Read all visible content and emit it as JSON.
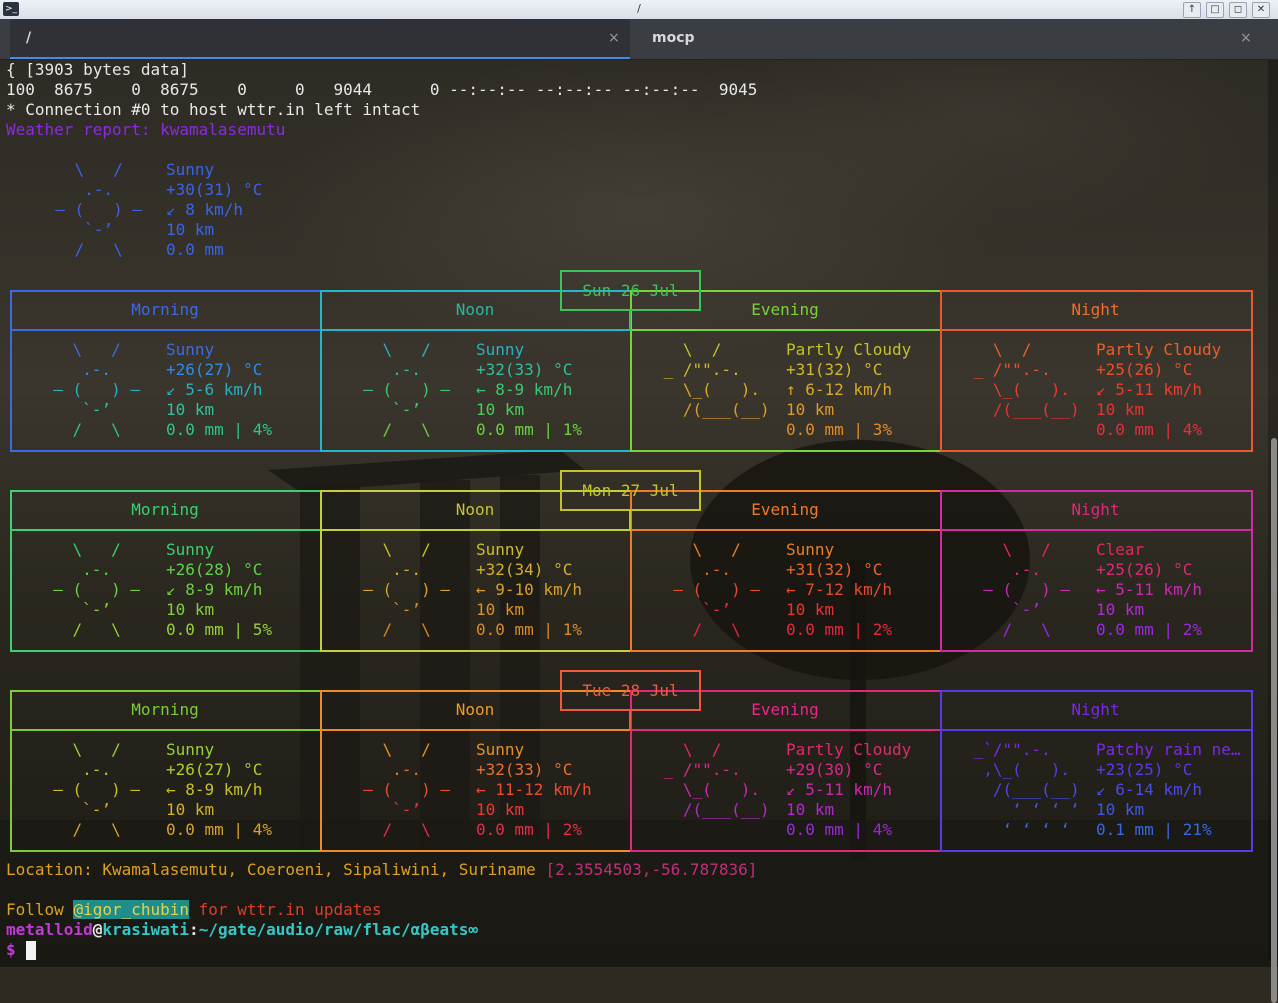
{
  "window": {
    "title": "/",
    "app_icon": ">_",
    "buttons": [
      "↑",
      "□",
      "◻",
      "✕"
    ]
  },
  "tabs": [
    {
      "label": "/",
      "active": true,
      "close": "×"
    },
    {
      "label": "mocp",
      "active": false,
      "close": "×"
    }
  ],
  "terminal": {
    "curl_lines": [
      "{ [3903 bytes data]",
      "100  8675    0  8675    0     0   9044      0 --:--:-- --:--:-- --:--:--  9045",
      "* Connection #0 to host wttr.in left intact"
    ],
    "report_title": "Weather report: kwamalasemutu",
    "current": {
      "art": [
        "    \\   /    ",
        "     .-.     ",
        "  ― (   ) ―  ",
        "     `-’     ",
        "    /   \\    "
      ],
      "info": [
        "Sunny",
        "+30(31) °C",
        "↙ 8 km/h",
        "10 km",
        "0.0 mm"
      ]
    },
    "days": [
      {
        "date": "Sun 26 Jul",
        "periods": [
          {
            "name": "Morning",
            "art": [
              "    \\   /    ",
              "     .-.     ",
              "  ― (   ) ―  ",
              "     `-’     ",
              "    /   \\    "
            ],
            "info": [
              "Sunny",
              "+26(27) °C",
              "↙ 5-6 km/h",
              "10 km",
              "0.0 mm | 4%"
            ]
          },
          {
            "name": "Noon",
            "art": [
              "    \\   /    ",
              "     .-.     ",
              "  ― (   ) ―  ",
              "     `-’     ",
              "    /   \\    "
            ],
            "info": [
              "Sunny",
              "+32(33) °C",
              "← 8-9 km/h",
              "10 km",
              "0.0 mm | 1%"
            ]
          },
          {
            "name": "Evening",
            "art": [
              "   \\  /      ",
              " _ /\"\".-.    ",
              "   \\_(   ).  ",
              "   /(___(__) ",
              "             "
            ],
            "info": [
              "Partly Cloudy",
              "+31(32) °C",
              "↑ 6-12 km/h",
              "10 km",
              "0.0 mm | 3%"
            ]
          },
          {
            "name": "Night",
            "art": [
              "   \\  /      ",
              " _ /\"\".-.    ",
              "   \\_(   ).  ",
              "   /(___(__) ",
              "             "
            ],
            "info": [
              "Partly Cloudy",
              "+25(26) °C",
              "↙ 5-11 km/h",
              "10 km",
              "0.0 mm | 4%"
            ]
          }
        ]
      },
      {
        "date": "Mon 27 Jul",
        "periods": [
          {
            "name": "Morning",
            "art": [
              "    \\   /    ",
              "     .-.     ",
              "  ― (   ) ―  ",
              "     `-’     ",
              "    /   \\    "
            ],
            "info": [
              "Sunny",
              "+26(28) °C",
              "↙ 8-9 km/h",
              "10 km",
              "0.0 mm | 5%"
            ]
          },
          {
            "name": "Noon",
            "art": [
              "    \\   /    ",
              "     .-.     ",
              "  ― (   ) ―  ",
              "     `-’     ",
              "    /   \\    "
            ],
            "info": [
              "Sunny",
              "+32(34) °C",
              "← 9-10 km/h",
              "10 km",
              "0.0 mm | 1%"
            ]
          },
          {
            "name": "Evening",
            "art": [
              "    \\   /    ",
              "     .-.     ",
              "  ― (   ) ―  ",
              "     `-’     ",
              "    /   \\    "
            ],
            "info": [
              "Sunny",
              "+31(32) °C",
              "← 7-12 km/h",
              "10 km",
              "0.0 mm | 2%"
            ]
          },
          {
            "name": "Night",
            "art": [
              "    \\   /    ",
              "     .-.     ",
              "  ― (   ) ―  ",
              "     `-’     ",
              "    /   \\    "
            ],
            "info": [
              "Clear",
              "+25(26) °C",
              "← 5-11 km/h",
              "10 km",
              "0.0 mm | 2%"
            ]
          }
        ]
      },
      {
        "date": "Tue 28 Jul",
        "periods": [
          {
            "name": "Morning",
            "art": [
              "    \\   /    ",
              "     .-.     ",
              "  ― (   ) ―  ",
              "     `-’     ",
              "    /   \\    "
            ],
            "info": [
              "Sunny",
              "+26(27) °C",
              "← 8-9 km/h",
              "10 km",
              "0.0 mm | 4%"
            ]
          },
          {
            "name": "Noon",
            "art": [
              "    \\   /    ",
              "     .-.     ",
              "  ― (   ) ―  ",
              "     `-’     ",
              "    /   \\    "
            ],
            "info": [
              "Sunny",
              "+32(33) °C",
              "← 11-12 km/h",
              "10 km",
              "0.0 mm | 2%"
            ]
          },
          {
            "name": "Evening",
            "art": [
              "   \\  /      ",
              " _ /\"\".-.    ",
              "   \\_(   ).  ",
              "   /(___(__) ",
              "             "
            ],
            "info": [
              "Partly Cloudy",
              "+29(30) °C",
              "↙ 5-11 km/h",
              "10 km",
              "0.0 mm | 4%"
            ]
          },
          {
            "name": "Night",
            "art": [
              " _`/\"\".-.    ",
              "  ,\\_(   ).  ",
              "   /(___(__) ",
              "     ‘ ‘ ‘ ‘ ",
              "    ‘ ‘ ‘ ‘  "
            ],
            "info": [
              "Patchy rain ne…",
              "+23(25) °C",
              "↙ 6-14 km/h",
              "10 km",
              "0.1 mm | 21%"
            ]
          }
        ]
      }
    ],
    "location_prefix": "Location: Kwamalasemutu, Coeroeni, Sipaliwini, Suriname ",
    "location_coords": "[2.3554503,-56.787836]",
    "follow_prefix": "Follow ",
    "follow_handle": "@igor_chubin",
    "follow_suffix": " for wttr.in updates",
    "prompt": {
      "user": "metalloid",
      "at": "@",
      "host": "krasiwati",
      "colon": ":",
      "path": "~/gate/audio/raw/flac/αβeats∞",
      "symbol": "$ "
    }
  },
  "colors": {
    "text": "#e8e8e8",
    "report_title": "#8a2be2",
    "current": "#3b63e6",
    "prompt_user": "#c03ad6",
    "prompt_path": "#36c7c7",
    "follow_handle_bg": "#20a0a0",
    "follow_text": "#d6402c",
    "accent_tab": "#3d8ee8"
  }
}
